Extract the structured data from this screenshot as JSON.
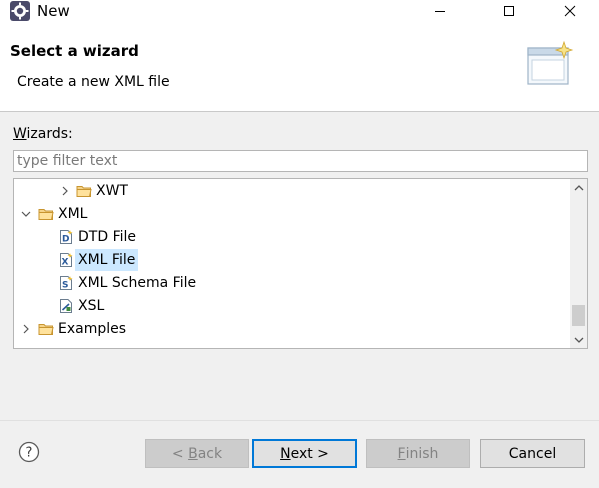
{
  "window": {
    "title": "New"
  },
  "header": {
    "title": "Select a wizard",
    "description": "Create a new XML file"
  },
  "wizards_label": {
    "accel": "W",
    "rest": "izards:"
  },
  "filter": {
    "placeholder": "type filter text",
    "value": ""
  },
  "tree": {
    "items": [
      {
        "label": "XWT",
        "level": 2,
        "icon": "folder-icon",
        "expanded": false
      },
      {
        "label": "XML",
        "level": 1,
        "icon": "folder-icon",
        "expanded": true
      },
      {
        "label": "DTD File",
        "level": 2,
        "icon": "dtd-file-icon"
      },
      {
        "label": "XML File",
        "level": 2,
        "icon": "xml-file-icon",
        "selected": true
      },
      {
        "label": "XML Schema File",
        "level": 2,
        "icon": "xml-schema-file-icon"
      },
      {
        "label": "XSL",
        "level": 2,
        "icon": "xsl-file-icon"
      },
      {
        "label": "Examples",
        "level": 1,
        "icon": "folder-icon",
        "expanded": false
      }
    ]
  },
  "buttons": {
    "back": {
      "prefix": "< ",
      "accel": "B",
      "rest": "ack",
      "enabled": false
    },
    "next": {
      "accel": "N",
      "rest": "ext >",
      "enabled": true
    },
    "finish": {
      "accel": "F",
      "rest": "inish",
      "enabled": false
    },
    "cancel": {
      "label": "Cancel",
      "enabled": true
    }
  },
  "colors": {
    "selection": "#cce8ff",
    "default_button_border": "#0078d7",
    "folder": "#e8b34a"
  }
}
